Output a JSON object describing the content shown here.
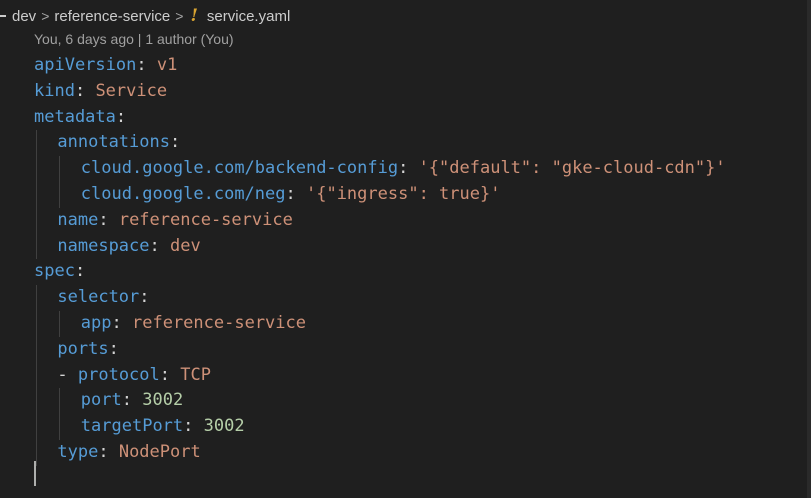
{
  "breadcrumb": {
    "items": [
      "dev",
      "reference-service",
      "service.yaml"
    ],
    "separator": ">",
    "file_icon": "!"
  },
  "blame": {
    "text": "You, 6 days ago | 1 author (You)"
  },
  "colors": {
    "background": "#1f1f1f",
    "key": "#569cd6",
    "string": "#ce9178",
    "number": "#b5cea8",
    "punctuation": "#d4d4d4",
    "yaml_icon": "#d9a431"
  },
  "code": {
    "lines": [
      {
        "indent": 0,
        "key": "apiVersion",
        "value": "v1",
        "type": "string"
      },
      {
        "indent": 0,
        "key": "kind",
        "value": "Service",
        "type": "string"
      },
      {
        "indent": 0,
        "key": "metadata",
        "value": "",
        "type": ""
      },
      {
        "indent": 1,
        "key": "annotations",
        "value": "",
        "type": ""
      },
      {
        "indent": 2,
        "key": "cloud.google.com/backend-config",
        "value": "'{\"default\": \"gke-cloud-cdn\"}'",
        "type": "string"
      },
      {
        "indent": 2,
        "key": "cloud.google.com/neg",
        "value": "'{\"ingress\": true}'",
        "type": "string"
      },
      {
        "indent": 1,
        "key": "name",
        "value": "reference-service",
        "type": "string"
      },
      {
        "indent": 1,
        "key": "namespace",
        "value": "dev",
        "type": "string"
      },
      {
        "indent": 0,
        "key": "spec",
        "value": "",
        "type": ""
      },
      {
        "indent": 1,
        "key": "selector",
        "value": "",
        "type": ""
      },
      {
        "indent": 2,
        "key": "app",
        "value": "reference-service",
        "type": "string"
      },
      {
        "indent": 1,
        "key": "ports",
        "value": "",
        "type": ""
      },
      {
        "indent": 1,
        "dash": true,
        "key": "protocol",
        "value": "TCP",
        "type": "string"
      },
      {
        "indent": 2,
        "key": "port",
        "value": "3002",
        "type": "number"
      },
      {
        "indent": 2,
        "key": "targetPort",
        "value": "3002",
        "type": "number"
      },
      {
        "indent": 1,
        "key": "type",
        "value": "NodePort",
        "type": "string"
      },
      {
        "indent": 0,
        "key": "",
        "value": "",
        "type": ""
      }
    ]
  }
}
